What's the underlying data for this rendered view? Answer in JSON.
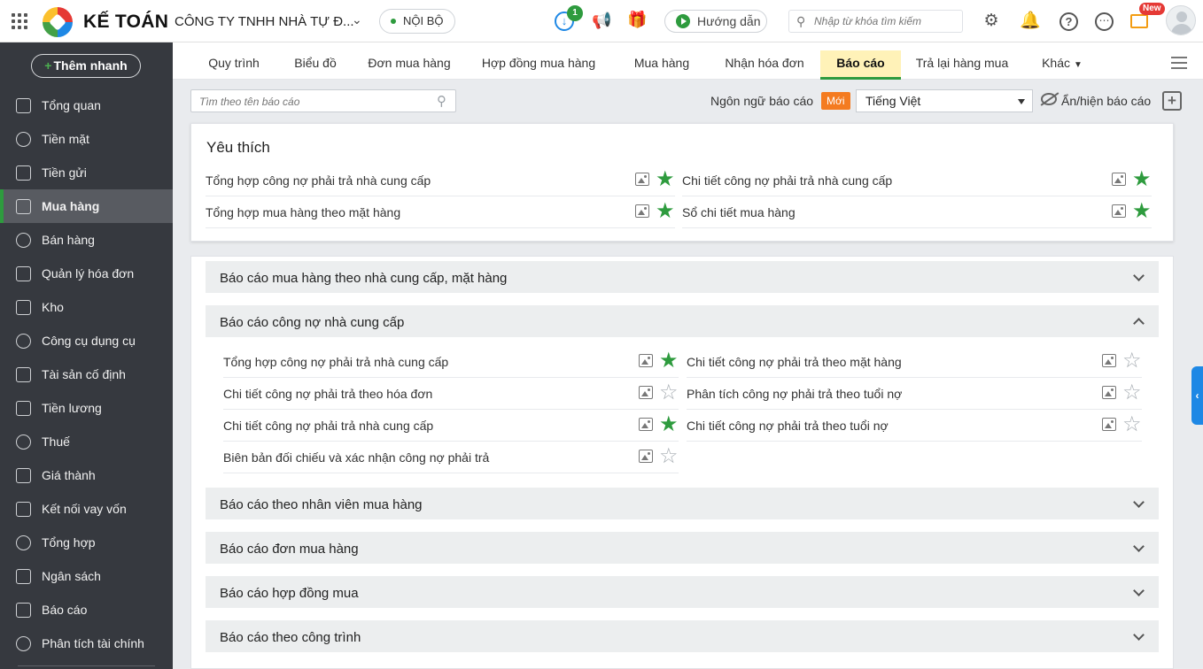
{
  "app": {
    "title": "KẾ TOÁN",
    "company": "CÔNG TY TNHH NHÀ TỰ Đ...",
    "scope": "NỘI BỘ",
    "download_count": "1",
    "guide_label": "Hướng dẫn",
    "search_placeholder": "Nhập từ khóa tìm kiếm",
    "new_badge": "New",
    "colors": {
      "accent": "#2e9b3e",
      "sidebar": "#36393f",
      "active_tab": "#fff2b8",
      "new_tag": "#f47b20"
    }
  },
  "sidebar": {
    "quick_add": "Thêm nhanh",
    "items": [
      {
        "label": "Tổng quan",
        "icon": "dashboard-icon"
      },
      {
        "label": "Tiền mặt",
        "icon": "cash-icon"
      },
      {
        "label": "Tiền gửi",
        "icon": "bank-icon"
      },
      {
        "label": "Mua hàng",
        "icon": "shopping-bag-icon",
        "active": true
      },
      {
        "label": "Bán hàng",
        "icon": "cart-icon"
      },
      {
        "label": "Quản lý hóa đơn",
        "icon": "invoice-icon"
      },
      {
        "label": "Kho",
        "icon": "warehouse-icon"
      },
      {
        "label": "Công cụ dụng cụ",
        "icon": "tools-icon"
      },
      {
        "label": "Tài sản cố định",
        "icon": "asset-icon"
      },
      {
        "label": "Tiền lương",
        "icon": "salary-icon"
      },
      {
        "label": "Thuế",
        "icon": "tax-icon"
      },
      {
        "label": "Giá thành",
        "icon": "price-tag-icon"
      },
      {
        "label": "Kết nối vay vốn",
        "icon": "loan-icon"
      },
      {
        "label": "Tổng hợp",
        "icon": "summary-icon"
      },
      {
        "label": "Ngân sách",
        "icon": "budget-icon"
      },
      {
        "label": "Báo cáo",
        "icon": "report-icon"
      },
      {
        "label": "Phân tích tài chính",
        "icon": "analysis-icon"
      }
    ]
  },
  "tabs": [
    {
      "label": "Quy trình"
    },
    {
      "label": "Biểu đồ"
    },
    {
      "label": "Đơn mua hàng"
    },
    {
      "label": "Hợp đồng mua hàng"
    },
    {
      "label": "Mua hàng"
    },
    {
      "label": "Nhận hóa đơn"
    },
    {
      "label": "Báo cáo",
      "active": true
    },
    {
      "label": "Trả lại hàng mua"
    },
    {
      "label": "Khác"
    }
  ],
  "filter": {
    "search_placeholder": "Tìm theo tên báo cáo",
    "lang_label": "Ngôn ngữ báo cáo",
    "new_tag": "Mới",
    "lang_value": "Tiếng Việt",
    "hide_label": "Ẩn/hiện báo cáo"
  },
  "favorites": {
    "title": "Yêu thích",
    "items": [
      {
        "label": "Tổng hợp công nợ phải trả nhà cung cấp",
        "starred": true
      },
      {
        "label": "Chi tiết công nợ phải trả nhà cung cấp",
        "starred": true
      },
      {
        "label": "Tổng hợp mua hàng theo mặt hàng",
        "starred": true
      },
      {
        "label": "Sổ chi tiết mua hàng",
        "starred": true
      }
    ]
  },
  "groups": [
    {
      "title": "Báo cáo mua hàng theo nhà cung cấp, mặt hàng",
      "expanded": false
    },
    {
      "title": "Báo cáo công nợ nhà cung cấp",
      "expanded": true,
      "items": [
        {
          "label": "Tổng hợp công nợ phải trả nhà cung cấp",
          "starred": true
        },
        {
          "label": "Chi tiết công nợ phải trả theo mặt hàng",
          "starred": false
        },
        {
          "label": "Chi tiết công nợ phải trả theo hóa đơn",
          "starred": false
        },
        {
          "label": "Phân tích công nợ phải trả theo tuổi nợ",
          "starred": false
        },
        {
          "label": "Chi tiết công nợ phải trả nhà cung cấp",
          "starred": true
        },
        {
          "label": "Chi tiết công nợ phải trả theo tuổi nợ",
          "starred": false
        },
        {
          "label": "Biên bản đối chiếu và xác nhận công nợ phải trả",
          "starred": false
        }
      ]
    },
    {
      "title": "Báo cáo theo nhân viên mua hàng",
      "expanded": false
    },
    {
      "title": "Báo cáo đơn mua hàng",
      "expanded": false
    },
    {
      "title": "Báo cáo hợp đồng mua",
      "expanded": false
    },
    {
      "title": "Báo cáo theo công trình",
      "expanded": false
    }
  ]
}
